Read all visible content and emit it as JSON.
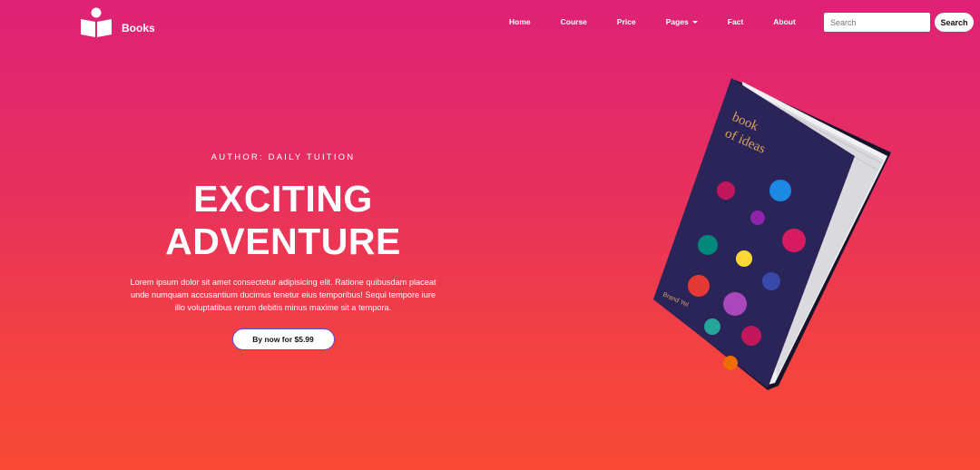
{
  "brand": {
    "name": "Books",
    "logo_icon": "book-reader-icon"
  },
  "nav": {
    "items": [
      {
        "label": "Home"
      },
      {
        "label": "Course"
      },
      {
        "label": "Price"
      },
      {
        "label": "Pages",
        "has_dropdown": true
      },
      {
        "label": "Fact"
      },
      {
        "label": "About"
      }
    ]
  },
  "search": {
    "placeholder": "Search",
    "value": "",
    "button_label": "Search"
  },
  "hero": {
    "eyebrow": "AUTHOR: DAILY TUITION",
    "title_line1": "EXCITING",
    "title_line2": "ADVENTURE",
    "description": "Lorem ipsum dolor sit amet consectetur adipisicing elit. Ratione quibusdam placeat unde numquam accusantium ducimus tenetur eius temporibus! Sequi tempore iure illo voluptatibus rerum debitis minus maxime sit a tempora.",
    "cta_label": "By now for $5.99"
  },
  "book": {
    "cover_title_line1": "book",
    "cover_title_line2": "of ideas",
    "cover_brand": "Brand Yel",
    "cover_color": "#2b2458"
  },
  "colors": {
    "gradient_top": "#dd2176",
    "gradient_bottom": "#f84a36",
    "button_border": "#5a4fd0"
  }
}
